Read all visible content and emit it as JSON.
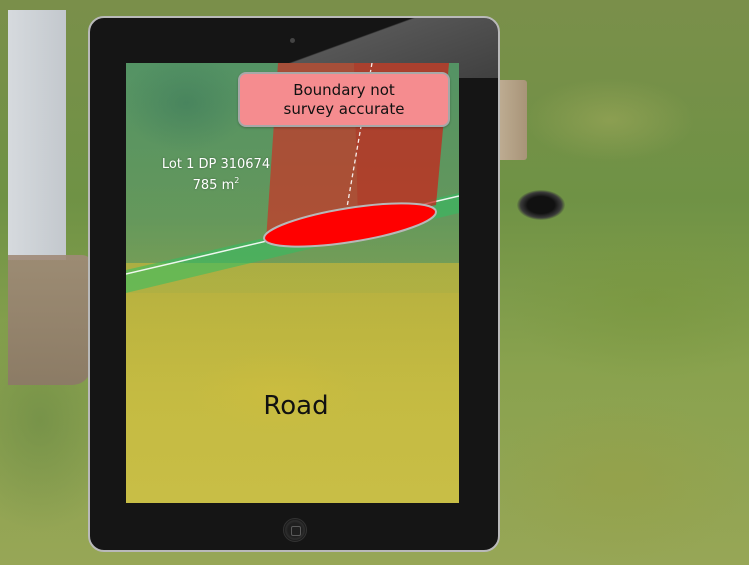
{
  "ar_view": {
    "boundary_warning": {
      "line1": "Boundary not",
      "line2": "survey accurate"
    },
    "parcel": {
      "name": "Lot 1 DP 310674",
      "area_value": "785 m",
      "area_unit_sup": "2"
    },
    "zone_label": "Road"
  },
  "colors": {
    "boundary_marker_fill": "#ff0000",
    "boundary_wall": "#d9251e",
    "parcel_band": "#2fbf63",
    "warning_badge": "#f58c8f",
    "tablet_frame": "#151515"
  },
  "icons": {
    "home_button": "home-button-icon",
    "camera": "camera-icon"
  }
}
